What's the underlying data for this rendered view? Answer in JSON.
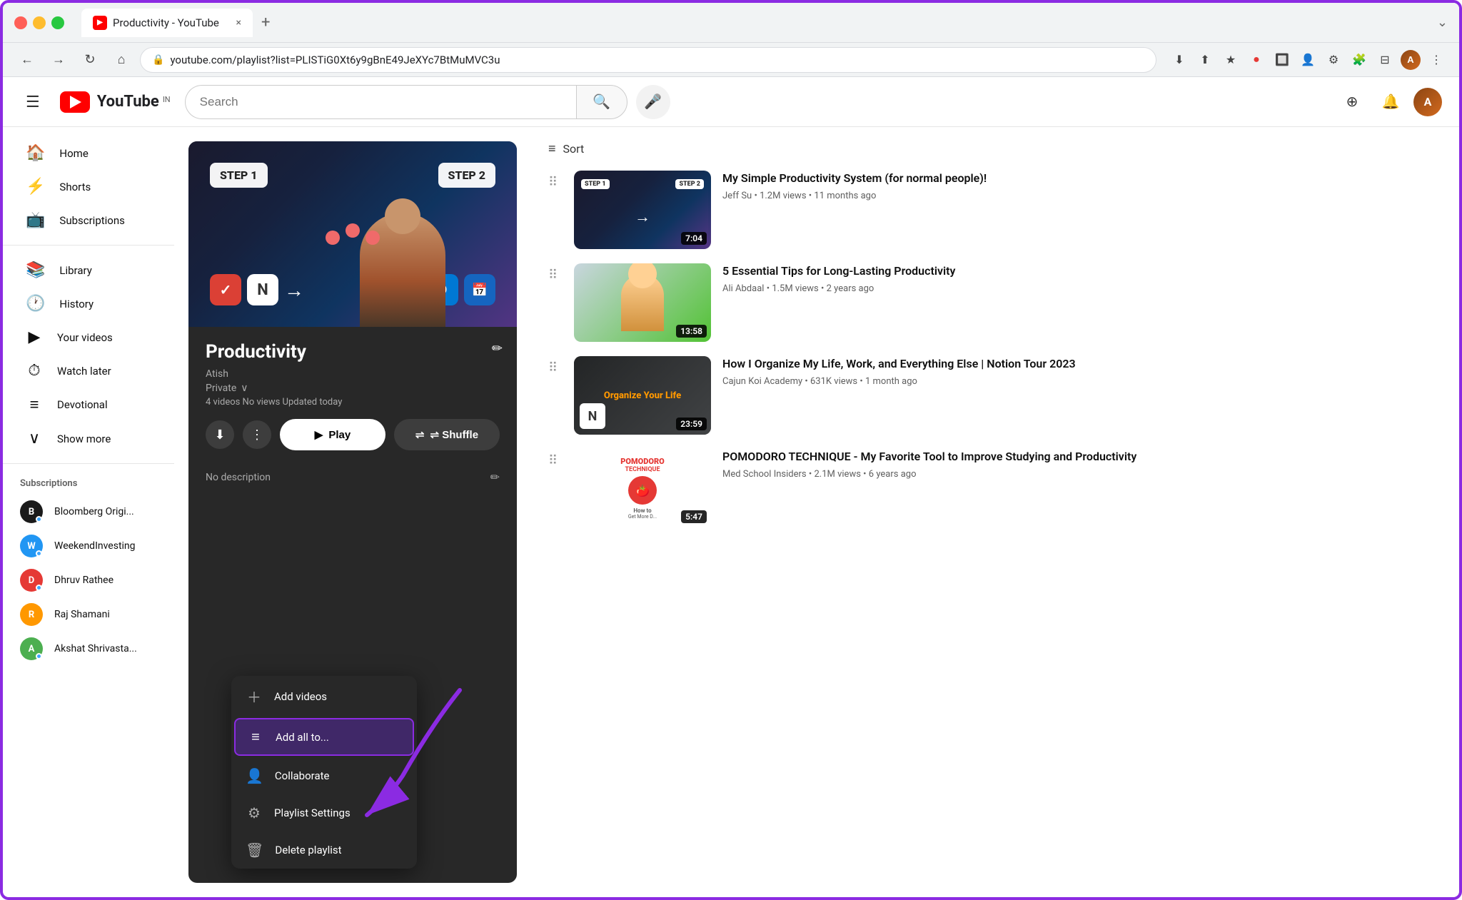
{
  "browser": {
    "tab_title": "Productivity - YouTube",
    "tab_close": "×",
    "tab_new": "+",
    "address": "youtube.com/playlist?list=PLISTiG0Xt6y9gBnE49JeXYc7BtMuMVC3u",
    "chevron_down": "⌄"
  },
  "youtube": {
    "logo_text": "YouTube",
    "logo_country": "IN",
    "search_placeholder": "Search",
    "header_buttons": {
      "create": "⊕",
      "notifications": "🔔",
      "account": "A"
    }
  },
  "sidebar": {
    "menu_icon": "☰",
    "items": [
      {
        "label": "Home",
        "icon": "🏠"
      },
      {
        "label": "Shorts",
        "icon": "⚡"
      },
      {
        "label": "Subscriptions",
        "icon": "📺"
      }
    ],
    "library_items": [
      {
        "label": "Library",
        "icon": "📚"
      },
      {
        "label": "History",
        "icon": "🕐"
      },
      {
        "label": "Your videos",
        "icon": "▶"
      },
      {
        "label": "Watch later",
        "icon": "⏱"
      },
      {
        "label": "Devotional",
        "icon": "≡"
      }
    ],
    "show_more": "Show more",
    "show_more_icon": "∨",
    "subscriptions_title": "Subscriptions",
    "subscriptions": [
      {
        "name": "Bloomberg Origi...",
        "initials": "B",
        "color": "#1a1a1a",
        "dot": true
      },
      {
        "name": "WeekendInvesting",
        "initials": "W",
        "color": "#2196f3",
        "dot": true
      },
      {
        "name": "Dhruv Rathee",
        "initials": "D",
        "color": "#e53935",
        "dot": true
      },
      {
        "name": "Raj Shamani",
        "initials": "R",
        "color": "#ff9800",
        "dot": false
      },
      {
        "name": "Akshat Shrivasta...",
        "initials": "A",
        "color": "#4caf50",
        "dot": true
      }
    ]
  },
  "playlist": {
    "title": "Productivity",
    "author": "Atish",
    "privacy": "Private",
    "meta": "4 videos  No views  Updated today",
    "desc_label": "No description",
    "play_label": "▶  Play",
    "shuffle_label": "⇌  Shuffle"
  },
  "dropdown": {
    "items": [
      {
        "label": "Add videos",
        "icon": "+"
      },
      {
        "label": "Add all to...",
        "icon": "≡+",
        "highlighted": true
      },
      {
        "label": "Collaborate",
        "icon": "👤"
      },
      {
        "label": "Playlist Settings",
        "icon": "⚙"
      },
      {
        "label": "Delete playlist",
        "icon": "🗑"
      }
    ]
  },
  "sort": {
    "label": "Sort",
    "icon": "≡"
  },
  "videos": [
    {
      "title": "My Simple Productivity System (for normal people)!",
      "channel": "Jeff Su",
      "views": "1.2M views",
      "age": "11 months ago",
      "duration": "7:04",
      "thumb_type": "step"
    },
    {
      "title": "5 Essential Tips for Long-Lasting Productivity",
      "channel": "Ali Abdaal",
      "views": "1.5M views",
      "age": "2 years ago",
      "duration": "13:58",
      "thumb_type": "person"
    },
    {
      "title": "How I Organize My Life, Work, and Everything Else | Notion Tour 2023",
      "channel": "Cajun Koi Academy",
      "views": "631K views",
      "age": "1 month ago",
      "duration": "23:59",
      "thumb_type": "notion"
    },
    {
      "title": "POMODORO TECHNIQUE - My Favorite Tool to Improve Studying and Productivity",
      "channel": "Med School Insiders",
      "views": "2.1M views",
      "age": "6 years ago",
      "duration": "5:47",
      "thumb_type": "pomodoro"
    }
  ],
  "colors": {
    "accent": "#8B2BE2",
    "yt_red": "#ff0000",
    "dark_bg": "#282828",
    "text_primary": "#0f0f0f",
    "text_secondary": "#606060"
  }
}
